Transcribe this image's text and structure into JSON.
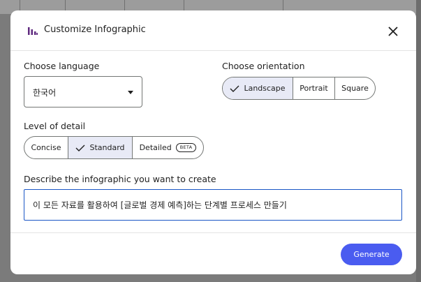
{
  "dialog": {
    "title": "Customize Infographic",
    "language_label": "Choose language",
    "language_value": "한국어",
    "orientation_label": "Choose orientation",
    "orientation_options": [
      "Landscape",
      "Portrait",
      "Square"
    ],
    "orientation_selected": "Landscape",
    "detail_label": "Level of detail",
    "detail_options": [
      "Concise",
      "Standard",
      "Detailed"
    ],
    "detail_selected": "Standard",
    "detail_badge": "BETA",
    "describe_label": "Describe the infographic you want to create",
    "describe_value": "이 모든 자료를 활용하여 [글로벌 경제 예측]하는 단계별 프로세스 만들기",
    "generate_label": "Generate"
  },
  "colors": {
    "accent": "#4a5cf0",
    "selected_bg": "#e8eaf6",
    "focus_border": "#1a56c6",
    "brand_icon": "#5f2a7f"
  },
  "icons": [
    "infographic-icon",
    "close-icon",
    "chevron-down-icon",
    "check-icon"
  ]
}
